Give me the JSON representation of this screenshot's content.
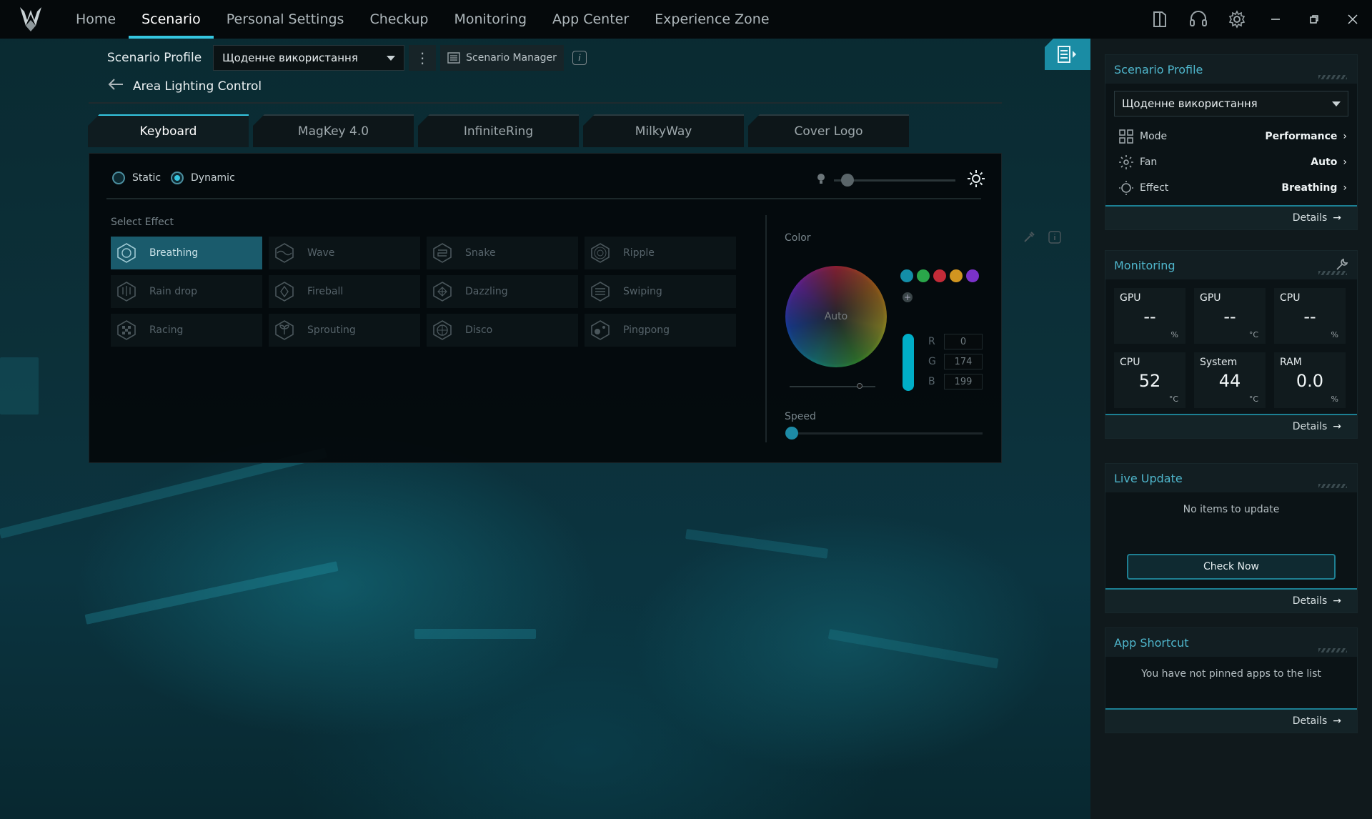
{
  "nav": {
    "items": [
      {
        "label": "Home",
        "active": false
      },
      {
        "label": "Scenario",
        "active": true
      },
      {
        "label": "Personal Settings",
        "active": false
      },
      {
        "label": "Checkup",
        "active": false
      },
      {
        "label": "Monitoring",
        "active": false
      },
      {
        "label": "App Center",
        "active": false
      },
      {
        "label": "Experience Zone",
        "active": false
      }
    ]
  },
  "profile_bar": {
    "label": "Scenario Profile",
    "selected": "Щоденне використання",
    "manager_label": "Scenario Manager"
  },
  "page": {
    "title": "Area Lighting Control"
  },
  "tabs": [
    "Keyboard",
    "MagKey 4.0",
    "InfiniteRing",
    "MilkyWay",
    "Cover Logo"
  ],
  "lighting": {
    "static_label": "Static",
    "dynamic_label": "Dynamic",
    "mode": "Dynamic",
    "select_effect_label": "Select Effect",
    "effects": [
      "Breathing",
      "Wave",
      "Snake",
      "Ripple",
      "Rain drop",
      "Fireball",
      "Dazzling",
      "Swiping",
      "Racing",
      "Sprouting",
      "Disco",
      "Pingpong"
    ],
    "selected_effect": "Breathing",
    "color_label": "Color",
    "wheel_label": "Auto",
    "swatches": [
      "#138ea8",
      "#2aa64a",
      "#c32b38",
      "#d19520",
      "#7b32c9"
    ],
    "rgb": {
      "r_label": "R",
      "g_label": "G",
      "b_label": "B",
      "r": "0",
      "g": "174",
      "b": "199"
    },
    "selected_color": "#00aec7",
    "speed_label": "Speed"
  },
  "right": {
    "scenario": {
      "title": "Scenario Profile",
      "selected": "Щоденне використання",
      "rows": [
        {
          "label": "Mode",
          "value": "Performance"
        },
        {
          "label": "Fan",
          "value": "Auto"
        },
        {
          "label": "Effect",
          "value": "Breathing"
        }
      ],
      "details": "Details"
    },
    "monitoring": {
      "title": "Monitoring",
      "cells": [
        {
          "name": "GPU",
          "value": "--",
          "unit": "%"
        },
        {
          "name": "GPU",
          "value": "--",
          "unit": "°C"
        },
        {
          "name": "CPU",
          "value": "--",
          "unit": "%"
        },
        {
          "name": "CPU",
          "value": "52",
          "unit": "°C"
        },
        {
          "name": "System",
          "value": "44",
          "unit": "°C"
        },
        {
          "name": "RAM",
          "value": "0.0",
          "unit": "%"
        }
      ],
      "details": "Details"
    },
    "live_update": {
      "title": "Live Update",
      "message": "No items to update",
      "button": "Check Now",
      "details": "Details"
    },
    "app_shortcut": {
      "title": "App Shortcut",
      "message": "You have not pinned apps to the list",
      "details": "Details"
    }
  }
}
